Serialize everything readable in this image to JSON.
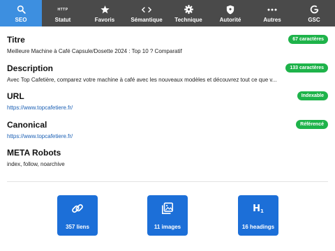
{
  "tabs": [
    {
      "label": "SEO",
      "icon": "search-icon",
      "active": true
    },
    {
      "label": "Statut",
      "icon": "http-icon",
      "icon_text": "HTTP"
    },
    {
      "label": "Favoris",
      "icon": "star-icon"
    },
    {
      "label": "Sémantique",
      "icon": "code-icon"
    },
    {
      "label": "Technique",
      "icon": "gear-icon"
    },
    {
      "label": "Autorité",
      "icon": "shield-icon"
    },
    {
      "label": "Autres",
      "icon": "more-icon"
    },
    {
      "label": "GSC",
      "icon": "google-icon"
    }
  ],
  "accent_color": "#3d8fe0",
  "badge_color": "#1eb34a",
  "sections": {
    "title": {
      "heading": "Titre",
      "value": "Meilleure Machine à Café Capsule/Dosette 2024 : Top 10 ? Comparatif",
      "badge": "67 caractères"
    },
    "description": {
      "heading": "Description",
      "value": "Avec Top Cafetière, comparez votre machine à café avec les nouveaux modèles et découvrez tout ce que v...",
      "badge": "133 caractères"
    },
    "url": {
      "heading": "URL",
      "value": "https://www.topcafetiere.fr/",
      "badge": "Indexable"
    },
    "canonical": {
      "heading": "Canonical",
      "value": "https://www.topcafetiere.fr/",
      "badge": "Référencé"
    },
    "meta_robots": {
      "heading": "META Robots",
      "value": "index, follow, noarchive"
    }
  },
  "cards": [
    {
      "label": "357 liens",
      "icon": "link-icon"
    },
    {
      "label": "11 images",
      "icon": "images-icon"
    },
    {
      "label": "16 headings",
      "icon": "h1-icon",
      "icon_text": "H",
      "icon_sub": "1"
    }
  ]
}
